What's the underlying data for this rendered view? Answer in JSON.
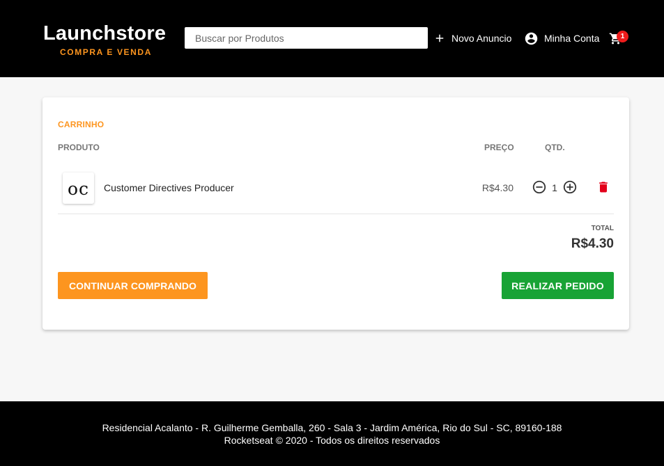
{
  "header": {
    "logo_title": "Launchstore",
    "logo_subtitle": "COMPRA E VENDA",
    "search_placeholder": "Buscar por Produtos",
    "nav": {
      "new_ad": "Novo Anuncio",
      "account": "Minha Conta",
      "cart_count": "1"
    }
  },
  "cart": {
    "title": "CARRINHO",
    "columns": {
      "product": "PRODUTO",
      "price": "PREÇO",
      "qty": "QTD."
    },
    "items": [
      {
        "thumb_text": "oc",
        "name": "Customer Directives Producer",
        "price": "R$4.30",
        "quantity": "1"
      }
    ],
    "total_label": "TOTAL",
    "total_value": "R$4.30",
    "continue_button": "CONTINUAR COMPRANDO",
    "order_button": "REALIZAR PEDIDO"
  },
  "footer": {
    "address": "Residencial Acalanto - R. Guilherme Gemballa, 260 - Sala 3 - Jardim América, Rio do Sul - SC, 89160-188",
    "copyright": "Rocketseat © 2020 - Todos os direitos reservados"
  },
  "icons": {
    "new_ad": "plus-icon",
    "account": "account-circle-icon",
    "cart": "shopping-cart-icon",
    "qty_minus": "minus-circle-icon",
    "qty_plus": "plus-circle-icon",
    "remove": "trash-icon"
  },
  "colors": {
    "header_bg": "#000000",
    "accent_orange": "#fd951f",
    "order_green": "#18a335",
    "badge_red": "#ee1c1c",
    "trash_red": "#e3001b"
  }
}
